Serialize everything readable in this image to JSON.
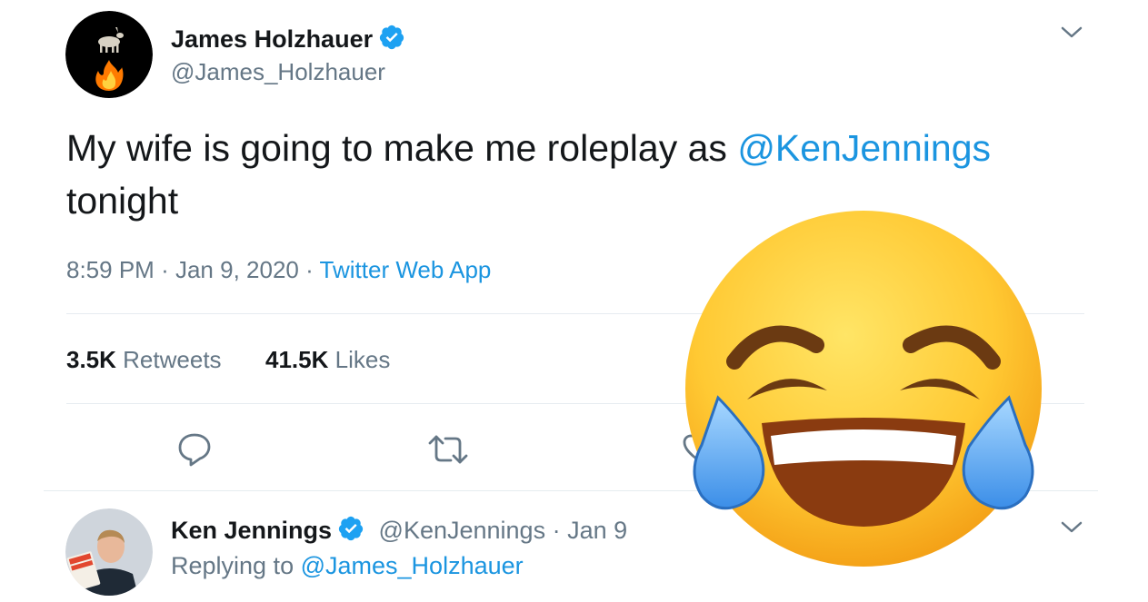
{
  "tweet": {
    "author_name": "James Holzhauer",
    "author_handle": "@James_Holzhauer",
    "text_before": "My wife is going to make me roleplay as ",
    "mention": "@KenJennings",
    "text_after": " tonight",
    "time": "8:59 PM",
    "date": "Jan 9, 2020",
    "separator": "·",
    "source": "Twitter Web App",
    "retweets_count": "3.5K",
    "retweets_label": "Retweets",
    "likes_count": "41.5K",
    "likes_label": "Likes"
  },
  "reply": {
    "author_name": "Ken Jennings",
    "author_handle": "@KenJennings",
    "separator": "·",
    "date": "Jan 9",
    "replying_prefix": "Replying to",
    "replying_to": "@James_Holzhauer"
  },
  "icons": {
    "verified": "verified-badge-icon",
    "reply": "reply-icon",
    "retweet": "retweet-icon",
    "menu": "chevron-down-icon",
    "overlay": "face-with-tears-of-joy-emoji"
  },
  "colors": {
    "link": "#1b95e0",
    "text": "#14171a",
    "muted": "#657786",
    "divider": "#e6ecf0"
  }
}
